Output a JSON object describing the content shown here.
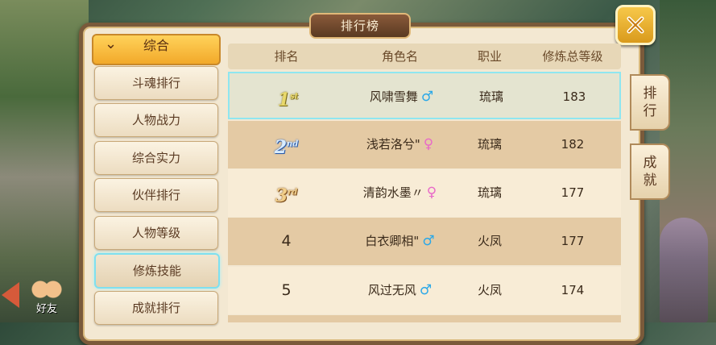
{
  "window": {
    "title": "排行榜"
  },
  "menu": {
    "header": "综合",
    "items": [
      {
        "label": "斗魂排行",
        "active": false
      },
      {
        "label": "人物战力",
        "active": false
      },
      {
        "label": "综合实力",
        "active": false
      },
      {
        "label": "伙伴排行",
        "active": false
      },
      {
        "label": "人物等级",
        "active": false
      },
      {
        "label": "修炼技能",
        "active": true
      },
      {
        "label": "成就排行",
        "active": false
      }
    ]
  },
  "table": {
    "headers": [
      "排名",
      "角色名",
      "职业",
      "修炼总等级"
    ],
    "rows": [
      {
        "rank": "1",
        "rank_suffix": "st",
        "name": "风啸雪舞",
        "gender": "♂",
        "job": "琉璃",
        "level": "183"
      },
      {
        "rank": "2",
        "rank_suffix": "nd",
        "name": "浅若洛兮\"",
        "gender": "♀",
        "job": "琉璃",
        "level": "182"
      },
      {
        "rank": "3",
        "rank_suffix": "rd",
        "name": "清韵水墨〃",
        "gender": "♀",
        "job": "琉璃",
        "level": "177"
      },
      {
        "rank": "4",
        "rank_suffix": "",
        "name": "白衣卿相\"",
        "gender": "♂",
        "job": "火凤",
        "level": "177"
      },
      {
        "rank": "5",
        "rank_suffix": "",
        "name": "风过无风",
        "gender": "♂",
        "job": "火凤",
        "level": "174"
      }
    ]
  },
  "side_tabs": [
    {
      "line1": "排",
      "line2": "行"
    },
    {
      "line1": "成",
      "line2": "就"
    }
  ],
  "friend_button": {
    "label": "好友"
  },
  "icons": {
    "close": "close-x-icon",
    "chevron": "chevron-down-icon",
    "friends": "friends-icon",
    "back": "arrow-left-icon"
  },
  "colors": {
    "accent_gold": "#f2a92a",
    "highlight_cyan": "#8fe6f0",
    "male": "#2aa8e8",
    "female": "#e86ac8"
  }
}
